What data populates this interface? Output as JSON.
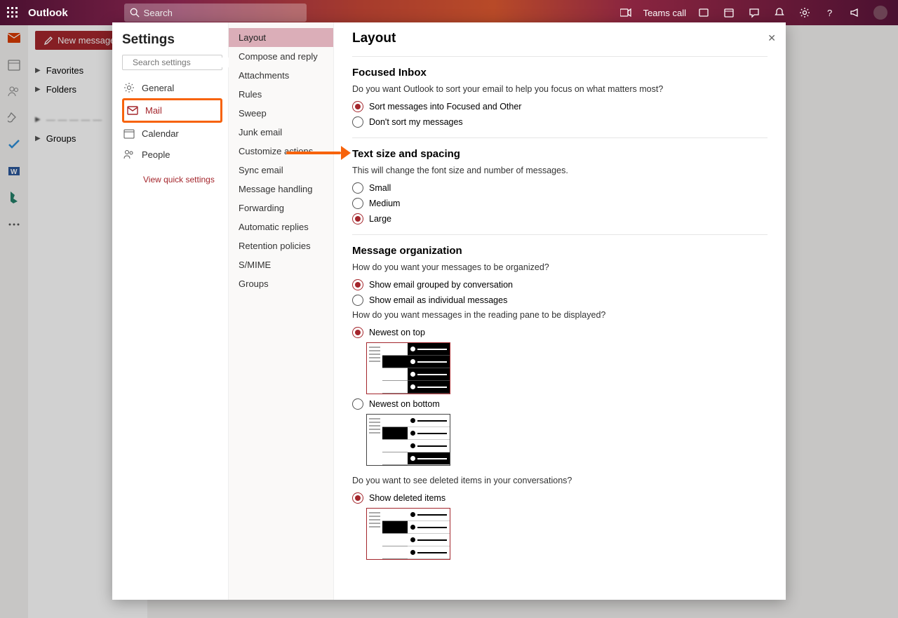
{
  "topbar": {
    "brand": "Outlook",
    "search_placeholder": "Search",
    "teams_label": "Teams call"
  },
  "newmsg": "New message",
  "nav": {
    "fav": "Favorites",
    "folders": "Folders",
    "groups": "Groups"
  },
  "settings": {
    "title": "Settings",
    "search_placeholder": "Search settings",
    "categories": {
      "general": "General",
      "mail": "Mail",
      "calendar": "Calendar",
      "people": "People"
    },
    "viewquick": "View quick settings",
    "sub": {
      "layout": "Layout",
      "compose": "Compose and reply",
      "attachments": "Attachments",
      "rules": "Rules",
      "sweep": "Sweep",
      "junk": "Junk email",
      "customize": "Customize actions",
      "sync": "Sync email",
      "msghandling": "Message handling",
      "forwarding": "Forwarding",
      "autorep": "Automatic replies",
      "retention": "Retention policies",
      "smime": "S/MIME",
      "groups": "Groups"
    }
  },
  "main": {
    "title": "Layout",
    "focused": {
      "h": "Focused Inbox",
      "q": "Do you want Outlook to sort your email to help you focus on what matters most?",
      "opt1": "Sort messages into Focused and Other",
      "opt2": "Don't sort my messages"
    },
    "textsize": {
      "h": "Text size and spacing",
      "q": "This will change the font size and number of messages.",
      "small": "Small",
      "medium": "Medium",
      "large": "Large"
    },
    "org": {
      "h": "Message organization",
      "q1": "How do you want your messages to be organized?",
      "grp": "Show email grouped by conversation",
      "ind": "Show email as individual messages",
      "q2": "How do you want messages in the reading pane to be displayed?",
      "ntop": "Newest on top",
      "nbot": "Newest on bottom",
      "q3": "Do you want to see deleted items in your conversations?",
      "showdel": "Show deleted items"
    }
  }
}
